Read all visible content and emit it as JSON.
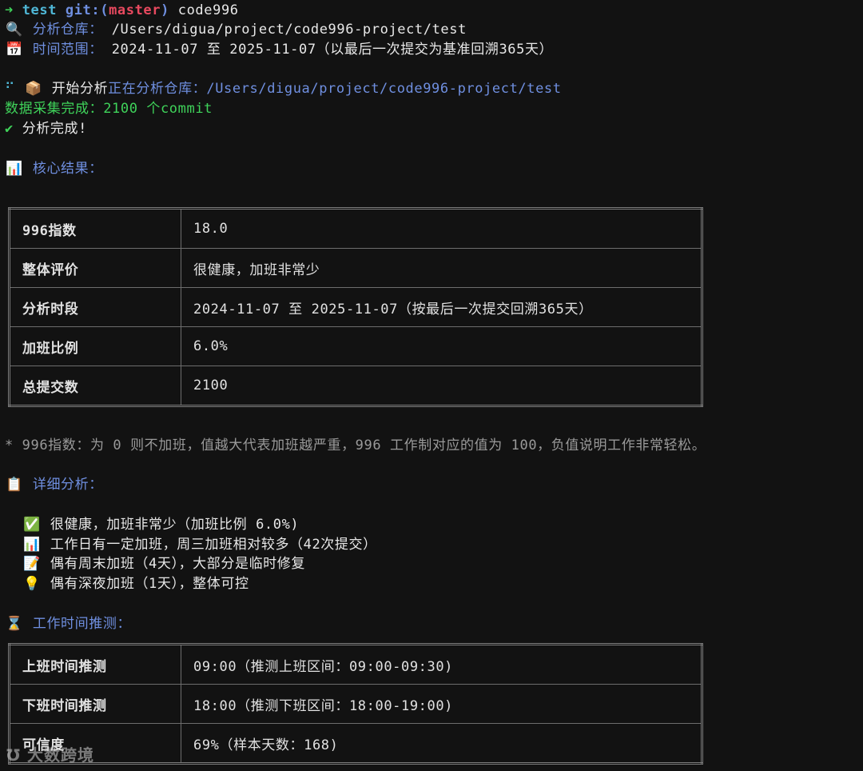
{
  "prompt": {
    "arrow": "➜",
    "dir": "test",
    "git_label": "git:(",
    "branch": "master",
    "git_close": ")",
    "command": "code996"
  },
  "header": {
    "repo_icon": "magnifier-icon",
    "repo_label": "分析仓库：",
    "repo_path": "/Users/digua/project/code996-project/test",
    "range_icon": "calendar-icon",
    "range_label": "时间范围：",
    "range_value": "2024-11-07 至 2025-11-07（以最后一次提交为基准回溯365天）"
  },
  "progress": {
    "spinner": "⠋",
    "start_icon": "package-icon",
    "start_label": "开始分析",
    "analyzing": "正在分析仓库：/Users/digua/project/code996-project/test",
    "collected": "数据采集完成：2100 个commit",
    "done_check": "✔",
    "done": "分析完成!"
  },
  "core": {
    "icon": "bar-chart-icon",
    "title": "核心结果：",
    "rows": [
      {
        "key": "996指数",
        "value": "18.0"
      },
      {
        "key": "整体评价",
        "value": "很健康，加班非常少"
      },
      {
        "key": "分析时段",
        "value": "2024-11-07 至 2025-11-07（按最后一次提交回溯365天）"
      },
      {
        "key": "加班比例",
        "value": "6.0%"
      },
      {
        "key": "总提交数",
        "value": "2100"
      }
    ],
    "footnote": "* 996指数：为 0 则不加班，值越大代表加班越严重，996 工作制对应的值为 100，负值说明工作非常轻松。"
  },
  "detail": {
    "icon": "clipboard-icon",
    "title": "详细分析：",
    "items": [
      {
        "icon": "check-icon",
        "text": "很健康，加班非常少（加班比例 6.0%)"
      },
      {
        "icon": "bar-chart-icon",
        "text": "工作日有一定加班，周三加班相对较多（42次提交）"
      },
      {
        "icon": "memo-icon",
        "text": "偶有周末加班（4天），大部分是临时修复"
      },
      {
        "icon": "lightbulb-icon",
        "text": "偶有深夜加班（1天），整体可控"
      }
    ]
  },
  "worktime": {
    "icon": "hourglass-icon",
    "title": "工作时间推测：",
    "rows": [
      {
        "key": "上班时间推测",
        "value": "09:00（推测上班区间：09:00-09:30)"
      },
      {
        "key": "下班时间推测",
        "value": "18:00（推测下班区间：18:00-19:00)"
      },
      {
        "key": "可信度",
        "value": "69%（样本天数：168)"
      }
    ]
  },
  "watermark": "大数跨境",
  "colors": {
    "background": "#121212",
    "prompt_green": "#3fd35a",
    "branch_red": "#e8495f",
    "label_blue": "#6f8fe0",
    "index_yellow": "#d5b52c",
    "ratio_orange": "#e45b3d"
  }
}
